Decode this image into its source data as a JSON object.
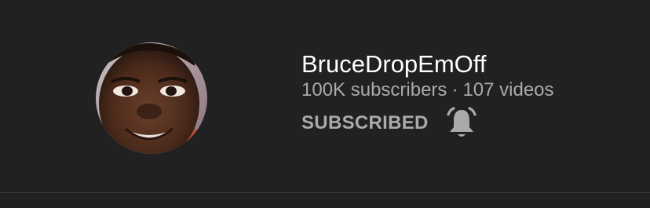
{
  "channel": {
    "name": "BruceDropEmOff",
    "subscribers": "100K subscribers",
    "separator": "·",
    "videos": "107 videos"
  },
  "subscribe": {
    "label": "SUBSCRIBED",
    "bell_icon": "notification-bell-icon"
  },
  "colors": {
    "background": "#212121",
    "title": "#ffffff",
    "secondary_text": "#aaaaaa",
    "divider": "#3d3d3d"
  }
}
